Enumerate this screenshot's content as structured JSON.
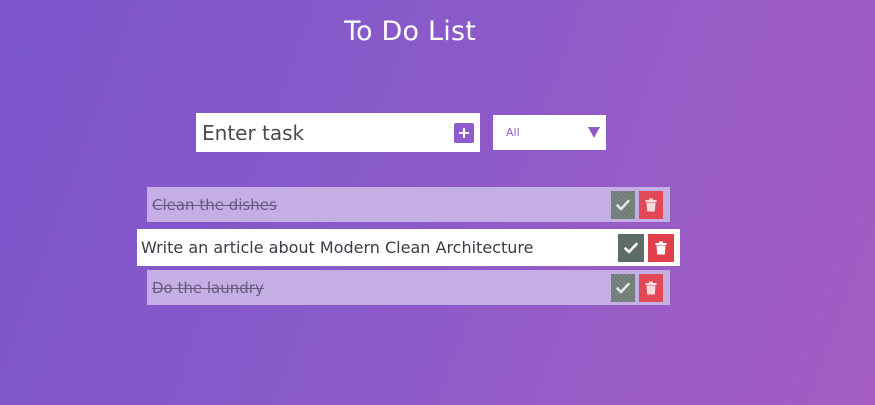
{
  "app": {
    "title": "To Do List"
  },
  "form": {
    "input_placeholder": "Enter task",
    "input_value": "",
    "add_icon": "plus-square-icon",
    "filter": {
      "selected": "All",
      "options": [
        "All"
      ]
    }
  },
  "todos": [
    {
      "text": "Clean the dishes",
      "completed": true
    },
    {
      "text": "Write an article about Modern Clean Architecture",
      "completed": false
    },
    {
      "text": "Do the laundry",
      "completed": true
    }
  ],
  "colors": {
    "accent": "#8e5bc9",
    "check": "#5c6e66",
    "trash": "#e0404a",
    "completed_row": "#c4aee4"
  },
  "icons": {
    "check": "check-icon",
    "trash": "trash-icon"
  }
}
